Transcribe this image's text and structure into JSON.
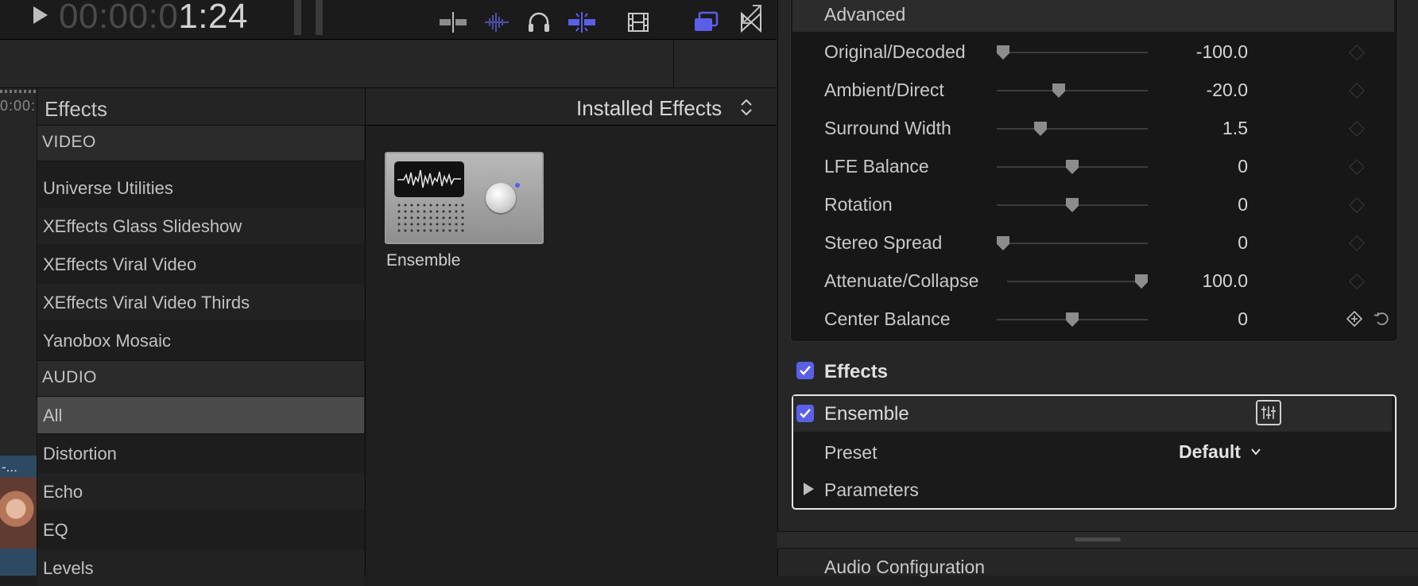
{
  "transport": {
    "timecode_dim": "00:00:0",
    "timecode_lit": "1:24"
  },
  "browser": {
    "strip_timecode": "0:00:",
    "strip_clip_label": "-...",
    "sidebar_header": "Effects",
    "categories": {
      "video": "VIDEO",
      "audio": "AUDIO"
    },
    "video_items": [
      "Universe Utilities",
      "XEffects Glass Slideshow",
      "XEffects Viral Video",
      "XEffects Viral Video Thirds",
      "Yanobox Mosaic"
    ],
    "audio_items": [
      "All",
      "Distortion",
      "Echo",
      "EQ",
      "Levels"
    ],
    "selected_audio_item": "All",
    "installed_label": "Installed Effects",
    "effect_tile": {
      "name": "Ensemble"
    }
  },
  "inspector": {
    "advanced_label": "Advanced",
    "parameters": [
      {
        "label": "Original/Decoded",
        "value": "-100.0",
        "level": 0.0
      },
      {
        "label": "Ambient/Direct",
        "value": "-20.0",
        "level": 0.4
      },
      {
        "label": "Surround Width",
        "value": "1.5",
        "level": 0.27
      },
      {
        "label": "LFE Balance",
        "value": "0",
        "level": 0.5
      },
      {
        "label": "Rotation",
        "value": "0",
        "level": 0.5
      },
      {
        "label": "Stereo Spread",
        "value": "0",
        "level": 0.0
      },
      {
        "label": "Attenuate/Collapse",
        "value": "100.0",
        "level": 1.0
      },
      {
        "label": "Center Balance",
        "value": "0",
        "level": 0.5
      }
    ],
    "effects_label": "Effects",
    "ensemble_label": "Ensemble",
    "preset_label": "Preset",
    "preset_value": "Default",
    "parameters_label": "Parameters",
    "audio_configuration_label": "Audio Configuration"
  },
  "colors": {
    "accent": "#5b5fe6",
    "background": "#1e1e1e"
  },
  "icons": {
    "play": "play-icon",
    "fullscreen": "fullscreen-icon",
    "toolbar": [
      "snapping-icon",
      "audio-skimming-icon",
      "solo-headphones-icon",
      "skimming-icon",
      "clip-appearance-icon",
      "browser-toggle-icon",
      "transitions-icon"
    ],
    "keyframe_add": "keyframe-add-icon",
    "reset": "reset-icon",
    "ensemble_controls": "effect-controls-icon"
  }
}
